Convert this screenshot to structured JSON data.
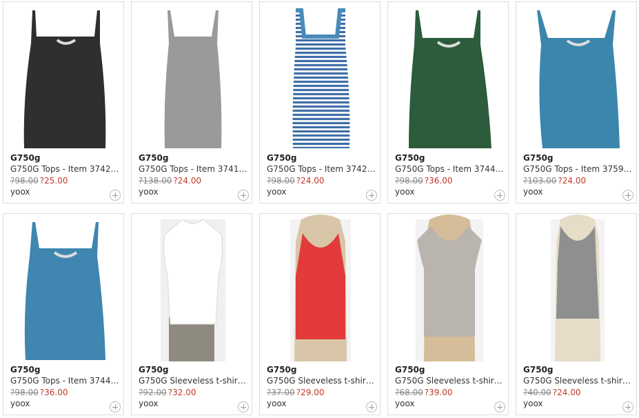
{
  "products": [
    {
      "brand": "G750g",
      "title": "G750G Tops - Item 3742…",
      "old_price": "?98.00",
      "new_price": "?25.00",
      "store": "yoox",
      "image": "black camisole with lace trim"
    },
    {
      "brand": "G750g",
      "title": "G750G Tops - Item 3741…",
      "old_price": "?138.00",
      "new_price": "?24.00",
      "store": "yoox",
      "image": "grey long camisole"
    },
    {
      "brand": "G750g",
      "title": "G750G Tops - Item 3742…",
      "old_price": "?98.00",
      "new_price": "?24.00",
      "store": "yoox",
      "image": "blue white striped tank"
    },
    {
      "brand": "G750g",
      "title": "G750G Tops - Item 3744…",
      "old_price": "?98.00",
      "new_price": "?36.00",
      "store": "yoox",
      "image": "green camisole with lace"
    },
    {
      "brand": "G750g",
      "title": "G750G Tops - Item 3759…",
      "old_price": "?103.00",
      "new_price": "?24.00",
      "store": "yoox",
      "image": "blue camisole with lace"
    },
    {
      "brand": "G750g",
      "title": "G750G Tops - Item 3744…",
      "old_price": "?98.00",
      "new_price": "?36.00",
      "store": "yoox",
      "image": "blue camisole with lace"
    },
    {
      "brand": "G750g",
      "title": "G750G Sleeveless t-shirt…",
      "old_price": "?92.00",
      "new_price": "?32.00",
      "store": "yoox",
      "image": "white sleeveless tee on mannequin"
    },
    {
      "brand": "G750g",
      "title": "G750G Sleeveless t-shirt…",
      "old_price": "?37.00",
      "new_price": "?29.00",
      "store": "yoox",
      "image": "red tank on mannequin"
    },
    {
      "brand": "G750g",
      "title": "G750G Sleeveless t-shirt…",
      "old_price": "?68.00",
      "new_price": "?39.00",
      "store": "yoox",
      "image": "grey henley tee on mannequin"
    },
    {
      "brand": "G750g",
      "title": "G750G Sleeveless t-shirt…",
      "old_price": "?40.00",
      "new_price": "?24.00",
      "store": "yoox",
      "image": "grey tank on mannequin"
    }
  ],
  "colors": {
    "old_price": "#888888",
    "new_price": "#c0392b",
    "border": "#dcdcdc"
  }
}
